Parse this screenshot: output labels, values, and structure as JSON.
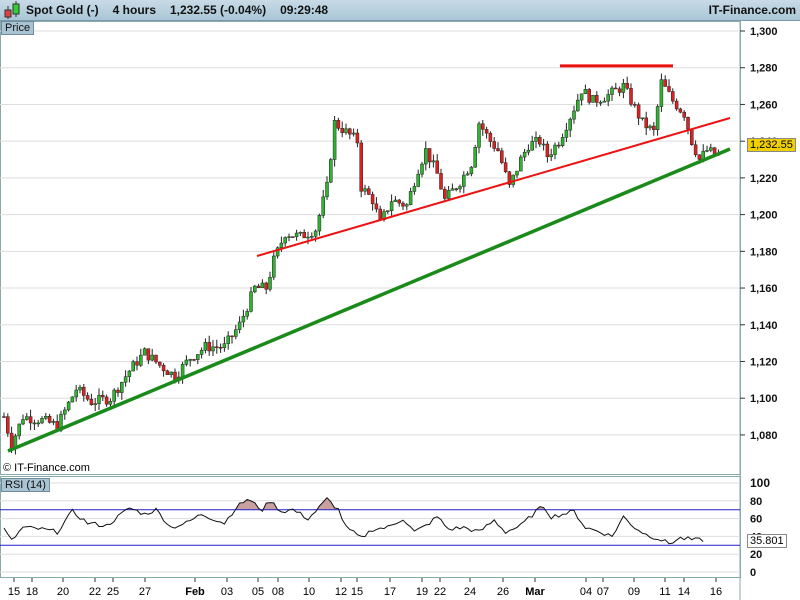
{
  "header": {
    "instrument": "Spot Gold (-)",
    "timeframe": "4 hours",
    "price_change": "1,232.55 (-0.04%)",
    "time": "09:29:48",
    "brand": "IT-Finance.com"
  },
  "price_panel": {
    "label": "Price",
    "current_price": "1,232.55",
    "watermark": "© IT-Finance.com"
  },
  "rsi_panel": {
    "label": "RSI (14)",
    "current_value": "35.801"
  },
  "colors": {
    "up": "#2db52d",
    "down": "#e02020",
    "support": "#1a8a1a",
    "resistance": "#ee1111",
    "rsi_band": "#2020cc",
    "overbought_fill": "#c9a0a0"
  },
  "chart_data": {
    "type": "candlestick",
    "y_ticks": [
      "1,080",
      "1,100",
      "1,120",
      "1,140",
      "1,160",
      "1,180",
      "1,200",
      "1,220",
      "1,240",
      "1,260",
      "1,280",
      "1,300"
    ],
    "y_values": [
      1080,
      1100,
      1120,
      1140,
      1160,
      1180,
      1200,
      1220,
      1240,
      1260,
      1280,
      1300
    ],
    "ylim": [
      1066,
      1303
    ],
    "x_labels": [
      "15",
      "18",
      "20",
      "22",
      "25",
      "27",
      "Feb",
      "03",
      "05",
      "08",
      "10",
      "12",
      "15",
      "17",
      "19",
      "22",
      "24",
      "26",
      "Mar",
      "04",
      "07",
      "09",
      "11",
      "14",
      "16"
    ],
    "close_path": [
      [
        0,
        1090
      ],
      [
        2,
        1075
      ],
      [
        5,
        1090
      ],
      [
        10,
        1088
      ],
      [
        14,
        1085
      ],
      [
        19,
        1105
      ],
      [
        23,
        1098
      ],
      [
        28,
        1100
      ],
      [
        33,
        1115
      ],
      [
        37,
        1125
      ],
      [
        41,
        1118
      ],
      [
        45,
        1112
      ],
      [
        49,
        1122
      ],
      [
        53,
        1128
      ],
      [
        58,
        1128
      ],
      [
        62,
        1140
      ],
      [
        66,
        1160
      ],
      [
        69,
        1160
      ],
      [
        71,
        1175
      ],
      [
        74,
        1190
      ],
      [
        78,
        1188
      ],
      [
        82,
        1192
      ],
      [
        85,
        1215
      ],
      [
        87,
        1250
      ],
      [
        90,
        1245
      ],
      [
        93,
        1240
      ],
      [
        94,
        1215
      ],
      [
        97,
        1208
      ],
      [
        99,
        1195
      ],
      [
        102,
        1208
      ],
      [
        106,
        1205
      ],
      [
        109,
        1225
      ],
      [
        111,
        1235
      ],
      [
        114,
        1222
      ],
      [
        116,
        1208
      ],
      [
        120,
        1218
      ],
      [
        123,
        1228
      ],
      [
        125,
        1250
      ],
      [
        128,
        1240
      ],
      [
        130,
        1235
      ],
      [
        133,
        1215
      ],
      [
        136,
        1230
      ],
      [
        138,
        1238
      ],
      [
        141,
        1240
      ],
      [
        143,
        1232
      ],
      [
        146,
        1240
      ],
      [
        150,
        1258
      ],
      [
        152,
        1268
      ],
      [
        155,
        1262
      ],
      [
        159,
        1265
      ],
      [
        163,
        1270
      ],
      [
        166,
        1258
      ],
      [
        168,
        1250
      ],
      [
        171,
        1245
      ],
      [
        173,
        1272
      ],
      [
        176,
        1262
      ],
      [
        179,
        1255
      ],
      [
        181,
        1240
      ],
      [
        183,
        1230
      ],
      [
        185,
        1235
      ],
      [
        188,
        1232
      ]
    ],
    "resistance_level": 1281,
    "rsi": {
      "ylim": [
        0,
        100
      ],
      "y_ticks": [
        "0",
        "20",
        "40",
        "60",
        "80",
        "100"
      ],
      "y_values": [
        0,
        20,
        40,
        60,
        80,
        100
      ],
      "overbought": 70,
      "oversold": 30,
      "path": [
        [
          0,
          48
        ],
        [
          2,
          35
        ],
        [
          5,
          50
        ],
        [
          10,
          48
        ],
        [
          14,
          45
        ],
        [
          18,
          68
        ],
        [
          22,
          55
        ],
        [
          27,
          52
        ],
        [
          33,
          72
        ],
        [
          37,
          65
        ],
        [
          40,
          70
        ],
        [
          44,
          50
        ],
        [
          48,
          55
        ],
        [
          52,
          65
        ],
        [
          58,
          55
        ],
        [
          61,
          72
        ],
        [
          64,
          82
        ],
        [
          68,
          70
        ],
        [
          70,
          80
        ],
        [
          73,
          68
        ],
        [
          76,
          70
        ],
        [
          80,
          60
        ],
        [
          82,
          68
        ],
        [
          85,
          82
        ],
        [
          88,
          70
        ],
        [
          90,
          50
        ],
        [
          94,
          38
        ],
        [
          97,
          48
        ],
        [
          101,
          50
        ],
        [
          105,
          60
        ],
        [
          108,
          45
        ],
        [
          111,
          52
        ],
        [
          114,
          62
        ],
        [
          117,
          48
        ],
        [
          121,
          50
        ],
        [
          125,
          45
        ],
        [
          129,
          58
        ],
        [
          132,
          45
        ],
        [
          136,
          52
        ],
        [
          140,
          68
        ],
        [
          142,
          74
        ],
        [
          144,
          62
        ],
        [
          147,
          65
        ],
        [
          150,
          68
        ],
        [
          153,
          50
        ],
        [
          157,
          45
        ],
        [
          160,
          40
        ],
        [
          163,
          62
        ],
        [
          166,
          50
        ],
        [
          169,
          42
        ],
        [
          172,
          38
        ],
        [
          175,
          32
        ],
        [
          178,
          38
        ],
        [
          182,
          36
        ],
        [
          184,
          36
        ]
      ]
    }
  }
}
